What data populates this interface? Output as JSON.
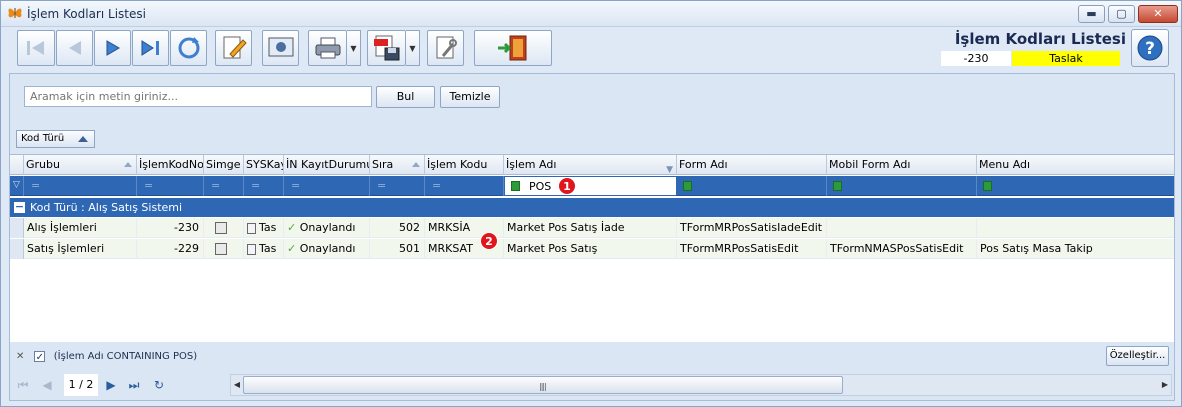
{
  "window": {
    "title": "İşlem Kodları Listesi"
  },
  "header": {
    "title": "İşlem Kodları Listesi",
    "code": "-230",
    "status": "Taslak"
  },
  "icons": {
    "app": "butterfly-icon",
    "toolbar": [
      "first-record-icon",
      "previous-record-icon",
      "next-record-icon",
      "last-record-icon",
      "refresh-icon",
      "edit-icon",
      "preview-icon",
      "print-icon",
      "export-pdf-icon",
      "tools-icon",
      "exit-icon",
      "help-icon"
    ]
  },
  "search": {
    "placeholder": "Aramak için metin giriniz...",
    "value": ""
  },
  "buttons": {
    "find": "Bul",
    "clear": "Temizle",
    "customize": "Özelleştir..."
  },
  "grouping": {
    "chip_label": "Kod Türü"
  },
  "grid": {
    "columns": [
      "Grubu",
      "İşlemKodNo",
      "Simge",
      "SYSKay",
      "İN KayıtDurumu",
      "Sıra",
      "İşlem Kodu",
      "İşlem Adı",
      "Form Adı",
      "Mobil Form Adı",
      "Menu Adı"
    ],
    "filter_value": "POS",
    "badges": [
      "1",
      "2"
    ],
    "group_label": "Kod Türü : Alış Satış Sistemi",
    "rows": [
      {
        "grubu": "Alış İşlemleri",
        "kodno": "-230",
        "syskay": "Tas",
        "durum": "Onaylandı",
        "sira": "502",
        "kodu": "MRKSİA",
        "adi": "Market Pos Satış İade",
        "form": "TFormMRPosSatisIadeEdit",
        "mobil": "",
        "menu": ""
      },
      {
        "grubu": "Satış İşlemleri",
        "kodno": "-229",
        "syskay": "Tas",
        "durum": "Onaylandı",
        "sira": "501",
        "kodu": "MRKSAT",
        "adi": "Market Pos Satış",
        "form": "TFormMRPosSatisEdit",
        "mobil": "TFormNMASPosSatisEdit",
        "menu": "Pos Satış Masa Takip"
      }
    ]
  },
  "filter_status": "(İşlem Adı CONTAINING POS)",
  "pager": {
    "page": "1 / 2"
  }
}
